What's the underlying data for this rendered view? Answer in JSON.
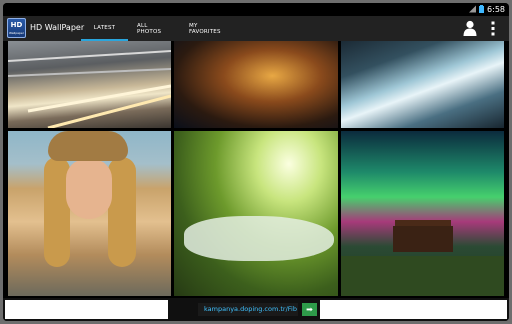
{
  "status_bar": {
    "time": "6:58",
    "icons": [
      "signal-icon",
      "battery-icon"
    ]
  },
  "action_bar": {
    "logo": {
      "big": "HD",
      "small": "Wallpaper"
    },
    "title": "HD WallPaper",
    "tabs": [
      {
        "label": "LATEST",
        "selected": true
      },
      {
        "label": "ALL PHOTOS",
        "selected": false
      },
      {
        "label": "MY FAVORITES",
        "selected": false
      }
    ],
    "accent_color": "#2aa6dd"
  },
  "wallpapers": [
    {
      "subject": "highway bridge with light trails"
    },
    {
      "subject": "city lights at night"
    },
    {
      "subject": "river rapids"
    },
    {
      "subject": "woman in hat"
    },
    {
      "subject": "forest stream in sunlight"
    },
    {
      "subject": "aurora over cabin"
    }
  ],
  "ad_banner": {
    "url_text": "kampanya.doping.com.tr/Fib",
    "go_symbol": "➡"
  }
}
